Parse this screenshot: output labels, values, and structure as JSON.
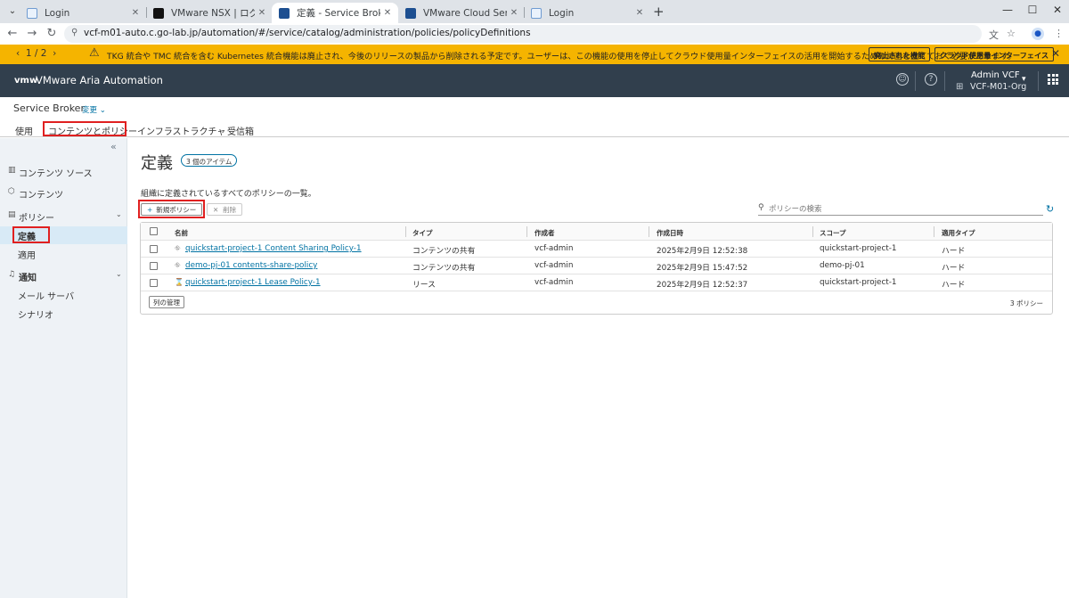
{
  "browser": {
    "tabs": [
      {
        "title": "Login",
        "icon": "page"
      },
      {
        "title": "VMware NSX | ログイン",
        "icon": "nsx"
      },
      {
        "title": "定義 - Service Broker",
        "icon": "vmw"
      },
      {
        "title": "VMware Cloud Services",
        "icon": "vmw"
      },
      {
        "title": "Login",
        "icon": "page"
      }
    ],
    "url": "vcf-m01-auto.c.go-lab.jp/automation/#/service/catalog/administration/policies/policyDefinitions"
  },
  "banner": {
    "pager": "1 / 2",
    "message": "TKG 統合や TMC 統合を含む Kubernetes 統合機能は廃止され、今後のリリースの製品から削除される予定です。ユーザーは、この機能の使用を停止してクラウド使用量インターフェイスの活用を開始するための計画を立てておく必要があります。",
    "btn_deprecated": "廃止された機能",
    "btn_cloud": "クラウド使用量インターフェイス",
    "color": "#f5b400"
  },
  "header": {
    "logo": "vmw",
    "app_name": "VMware Aria Automation",
    "user_name": "Admin VCF",
    "org_name": "VCF-M01-Org",
    "color": "#313f4d"
  },
  "subheader": {
    "service": "Service Broker",
    "change": "変更",
    "tabs": [
      "使用",
      "コンテンツとポリシー",
      "インフラストラクチャ",
      "受信箱"
    ]
  },
  "sidebar": {
    "items": [
      {
        "label": "コンテンツ ソース",
        "icon": "content-source-icon"
      },
      {
        "label": "コンテンツ",
        "icon": "content-icon"
      },
      {
        "label": "ポリシー",
        "icon": "policy-icon"
      },
      {
        "label": "定義"
      },
      {
        "label": "適用"
      },
      {
        "label": "通知",
        "icon": "bell-icon"
      },
      {
        "label": "メール サーバ"
      },
      {
        "label": "シナリオ"
      }
    ]
  },
  "main": {
    "title": "定義",
    "count_badge": "3 個のアイテム",
    "description": "組織に定義されているすべてのポリシーの一覧。",
    "new_policy": "新規ポリシー",
    "delete": "削除",
    "search_placeholder": "ポリシーの検索",
    "columns": [
      "名前",
      "タイプ",
      "作成者",
      "作成日時",
      "スコープ",
      "適用タイプ"
    ],
    "rows": [
      {
        "name": "quickstart-project-1 Content Sharing Policy-1",
        "type": "コンテンツの共有",
        "author": "vcf-admin",
        "created": "2025年2月9日 12:52:38",
        "scope": "quickstart-project-1",
        "enforcement": "ハード"
      },
      {
        "name": "demo-pj-01 contents-share-policy",
        "type": "コンテンツの共有",
        "author": "vcf-admin",
        "created": "2025年2月9日 15:47:52",
        "scope": "demo-pj-01",
        "enforcement": "ハード"
      },
      {
        "name": "quickstart-project-1 Lease Policy-1",
        "type": "リース",
        "author": "vcf-admin",
        "created": "2025年2月9日 12:52:37",
        "scope": "quickstart-project-1",
        "enforcement": "ハード"
      }
    ],
    "manage_columns": "列の管理",
    "footer_count": "3 ポリシー"
  }
}
